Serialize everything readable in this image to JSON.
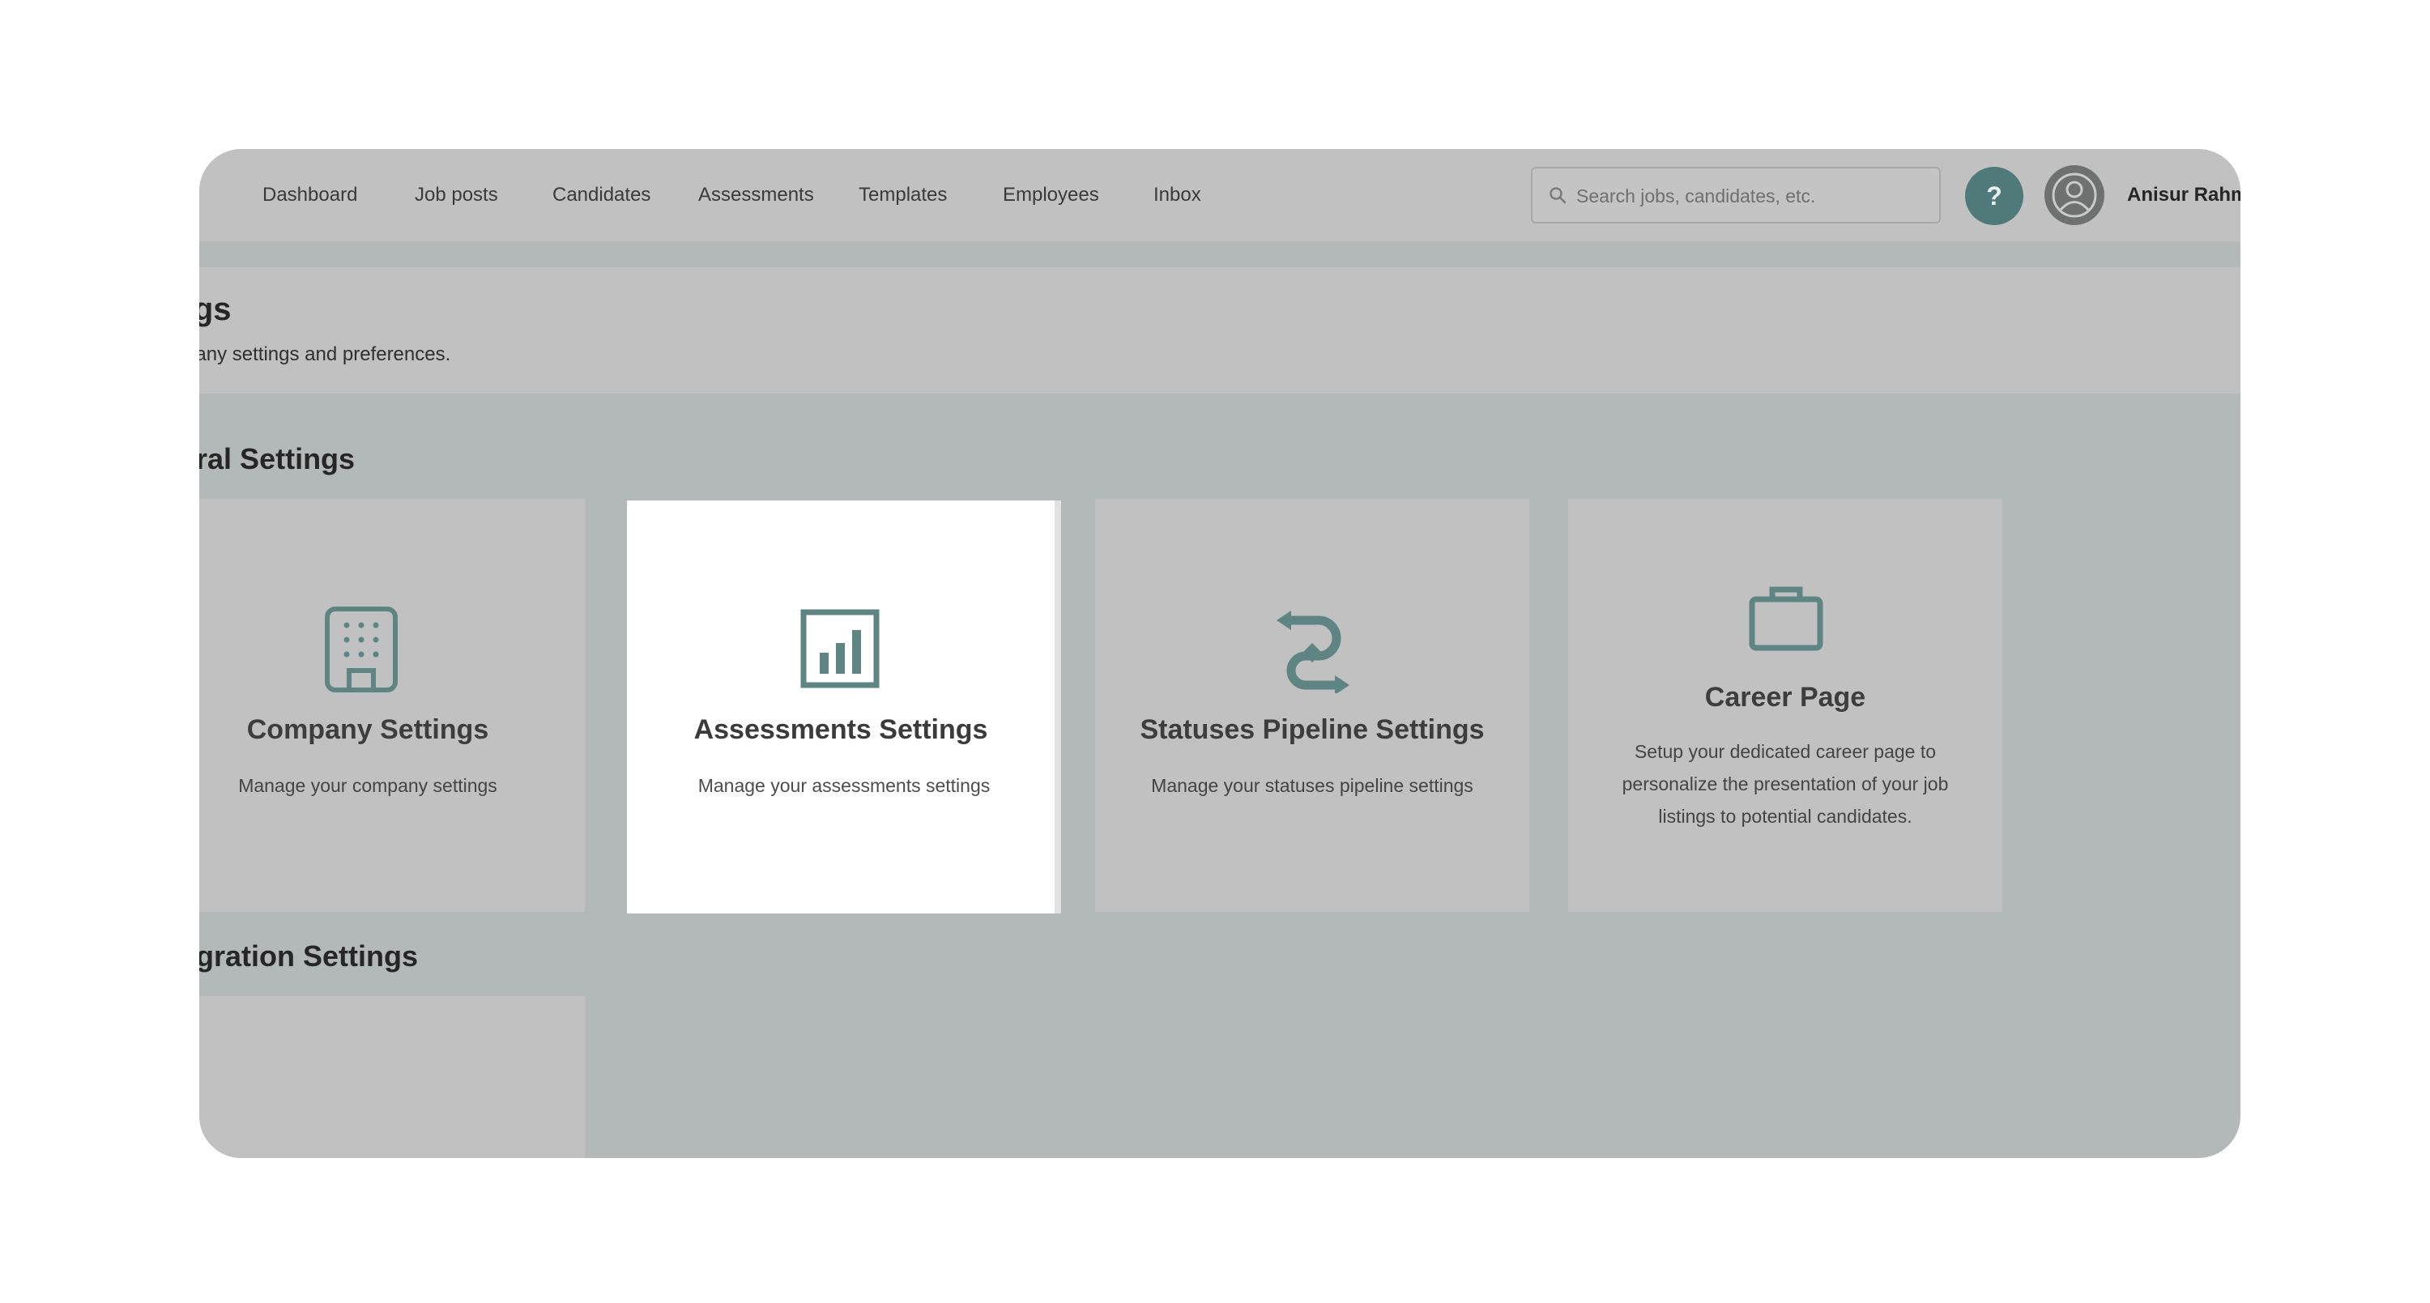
{
  "nav": {
    "items": [
      {
        "label": "Dashboard"
      },
      {
        "label": "Job posts"
      },
      {
        "label": "Candidates"
      },
      {
        "label": "Assessments"
      },
      {
        "label": "Templates"
      },
      {
        "label": "Employees"
      },
      {
        "label": "Inbox"
      }
    ]
  },
  "search": {
    "placeholder": "Search jobs, candidates, etc."
  },
  "help": {
    "label": "?"
  },
  "user": {
    "name": "Anisur Rahm"
  },
  "page": {
    "title": "tings",
    "subtitle": "ge your company settings and preferences."
  },
  "sections": {
    "general": "eral Settings",
    "integration": "gration Settings"
  },
  "cards": [
    {
      "title": "Company Settings",
      "description": "Manage your company settings",
      "icon": "building-icon"
    },
    {
      "title": "Assessments Settings",
      "description": "Manage your assessments settings",
      "icon": "bar-chart-icon"
    },
    {
      "title": "Statuses Pipeline Settings",
      "description": "Manage your statuses pipeline settings",
      "icon": "swap-arrows-icon"
    },
    {
      "title": "Career Page",
      "description": "Setup your dedicated career page to personalize the presentation of your job listings to potential candidates.",
      "icon": "briefcase-icon"
    }
  ],
  "colors": {
    "accent": "#4f7a79",
    "icon": "#5e8584",
    "overlay": "#b3b8b8",
    "surface": "#c1c1c1"
  }
}
